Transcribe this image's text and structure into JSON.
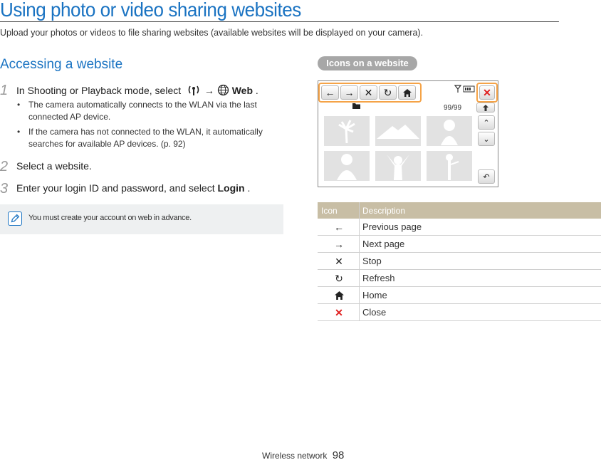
{
  "page": {
    "title": "Using photo or video sharing websites",
    "subtitle": "Upload your photos or videos to file sharing websites (available websites will be displayed on your camera)."
  },
  "accessing": {
    "heading": "Accessing a website",
    "steps": [
      {
        "num": "1",
        "text_before": "In Shooting or Playback mode, select",
        "arrow": "→",
        "web_label": "Web",
        "text_after": "."
      },
      {
        "num": "2",
        "text": "Select a website."
      },
      {
        "num": "3",
        "text_before": "Enter your login ID and password, and select",
        "login_label": "Login",
        "text_after": "."
      }
    ],
    "bullets": [
      "The camera automatically connects to the WLAN via the last connected AP device.",
      "If the camera has not connected to the WLAN, it automatically searches for available AP devices. (p. 92)"
    ],
    "bullet_char": "•",
    "note": "You must create your account on web in advance."
  },
  "icons_section": {
    "heading": "Icons on a website",
    "screen": {
      "counter": "99/99",
      "nav_icons": [
        "arrow-left-icon",
        "arrow-right-icon",
        "stop-icon",
        "refresh-icon",
        "home-icon"
      ],
      "close_icon": "close-icon",
      "close_color": "#e02020"
    },
    "table": {
      "headers": [
        "Icon",
        "Description"
      ],
      "rows": [
        {
          "icon": "←",
          "name": "arrow-left-icon",
          "desc": "Previous page"
        },
        {
          "icon": "→",
          "name": "arrow-right-icon",
          "desc": "Next page"
        },
        {
          "icon": "✕",
          "name": "stop-icon",
          "desc": "Stop"
        },
        {
          "icon": "↻",
          "name": "refresh-icon",
          "desc": "Refresh"
        },
        {
          "icon": "⌂",
          "name": "home-icon",
          "desc": "Home"
        },
        {
          "icon": "✕",
          "name": "close-icon",
          "desc": "Close"
        }
      ]
    }
  },
  "footer": {
    "section": "Wireless network",
    "page_number": "98"
  },
  "colors": {
    "accent": "#1a73c2",
    "highlight": "#f5a347",
    "table_header": "#c8bea5"
  }
}
